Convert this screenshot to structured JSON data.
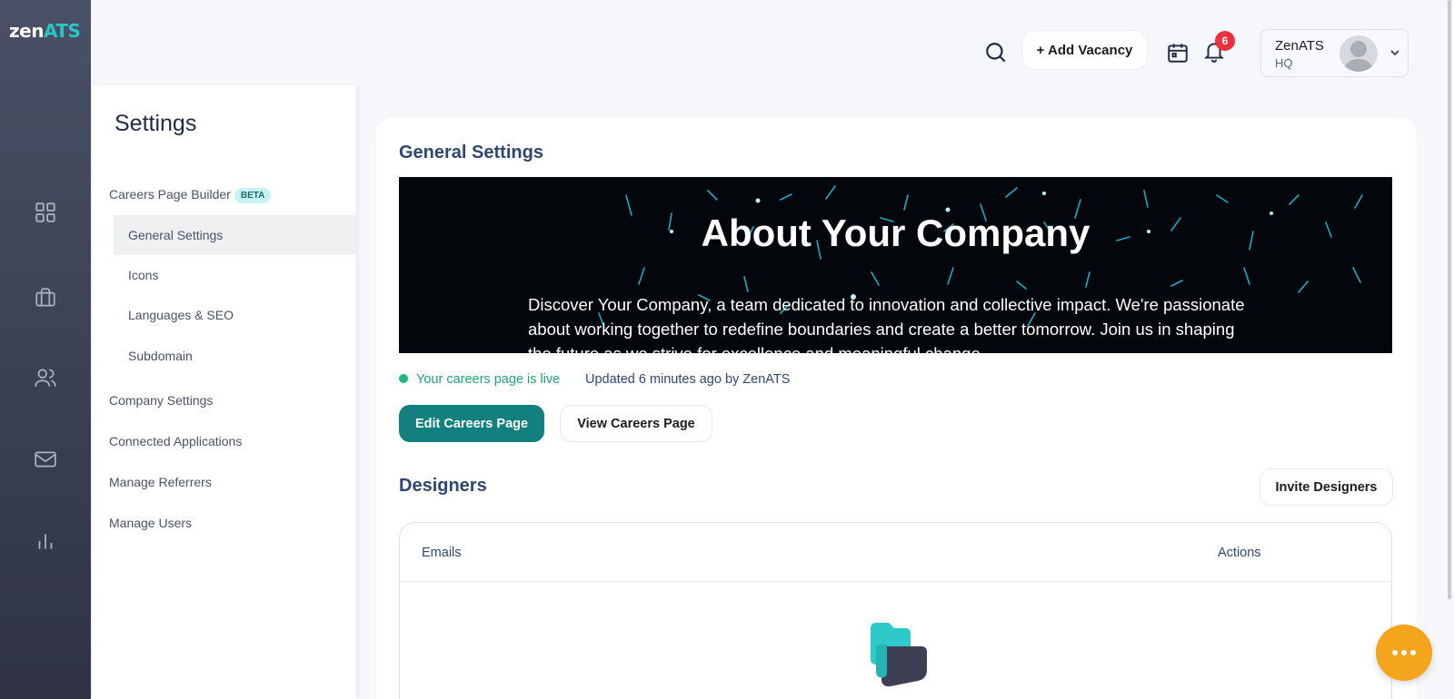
{
  "brand": {
    "logo_part1": "zen",
    "logo_part2": "ATS",
    "accent": "#2bc4c4"
  },
  "rail": {
    "icons": [
      "dashboard-icon",
      "briefcase-icon",
      "people-icon",
      "mail-icon",
      "chart-icon"
    ]
  },
  "header": {
    "add_vacancy_label": "+ Add Vacancy",
    "notification_count": "6",
    "user_name": "ZenATS",
    "user_org": "HQ"
  },
  "settings": {
    "title": "Settings",
    "careers_builder_label": "Careers Page Builder",
    "beta_label": "BETA",
    "sub_items": [
      "General Settings",
      "Icons",
      "Languages & SEO",
      "Subdomain"
    ],
    "active_sub_item": "General Settings",
    "items": [
      "Company Settings",
      "Connected Applications",
      "Manage Referrers",
      "Manage Users"
    ]
  },
  "main": {
    "title": "General Settings",
    "banner_title": "About Your Company",
    "banner_text": "Discover Your Company, a team dedicated to innovation and collective impact. We're passionate about working together to redefine boundaries and create a better tomorrow. Join us in shaping the future as we strive for excellence and meaningful change.",
    "live_status": "Your careers page is live",
    "updated_text": "Updated 6 minutes ago by ZenATS",
    "edit_button": "Edit Careers Page",
    "view_button": "View Careers Page",
    "designers_title": "Designers",
    "invite_button": "Invite Designers",
    "table_headers": [
      "Emails",
      "Actions"
    ]
  },
  "colors": {
    "primary": "#12807e",
    "live_green": "#1fa673",
    "badge_red": "#e8323f",
    "fab_orange": "#f4a51c"
  }
}
